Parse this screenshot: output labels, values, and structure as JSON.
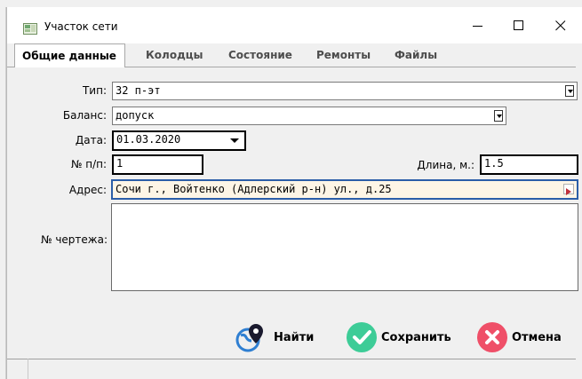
{
  "window": {
    "title": "Участок сети",
    "minimize_glyph": "—",
    "maximize_glyph": "☐",
    "close_glyph": "✕"
  },
  "tabs": [
    {
      "label": "Общие данные",
      "active": true
    },
    {
      "label": "Колодцы",
      "active": false
    },
    {
      "label": "Состояние",
      "active": false
    },
    {
      "label": "Ремонты",
      "active": false
    },
    {
      "label": "Файлы",
      "active": false
    }
  ],
  "form": {
    "type_label": "Тип:",
    "type_value": "32 п-эт",
    "balance_label": "Баланс:",
    "balance_value": "допуск",
    "date_label": "Дата:",
    "date_value": "01.03.2020",
    "number_label": "№ п/п:",
    "number_value": "1",
    "length_label": "Длина, м.:",
    "length_value": "1.5",
    "address_label": "Адрес:",
    "address_value": "Сочи г., Войтенко (Адлерский р-н) ул., д.25",
    "drawing_label": "№ чертежа:",
    "drawing_value": ""
  },
  "actions": {
    "find_label": "Найти",
    "save_label": "Сохранить",
    "cancel_label": "Отмена"
  },
  "colors": {
    "save_green": "#3dcc97",
    "cancel_red": "#ef4f68",
    "find_blue": "#3a8fd8",
    "address_bg": "#fdf5e6",
    "address_border": "#2b5ea8"
  },
  "icons": {
    "app": "folder-map-icon",
    "find": "map-pin-globe-icon",
    "save": "check-circle-icon",
    "cancel": "x-circle-icon"
  }
}
